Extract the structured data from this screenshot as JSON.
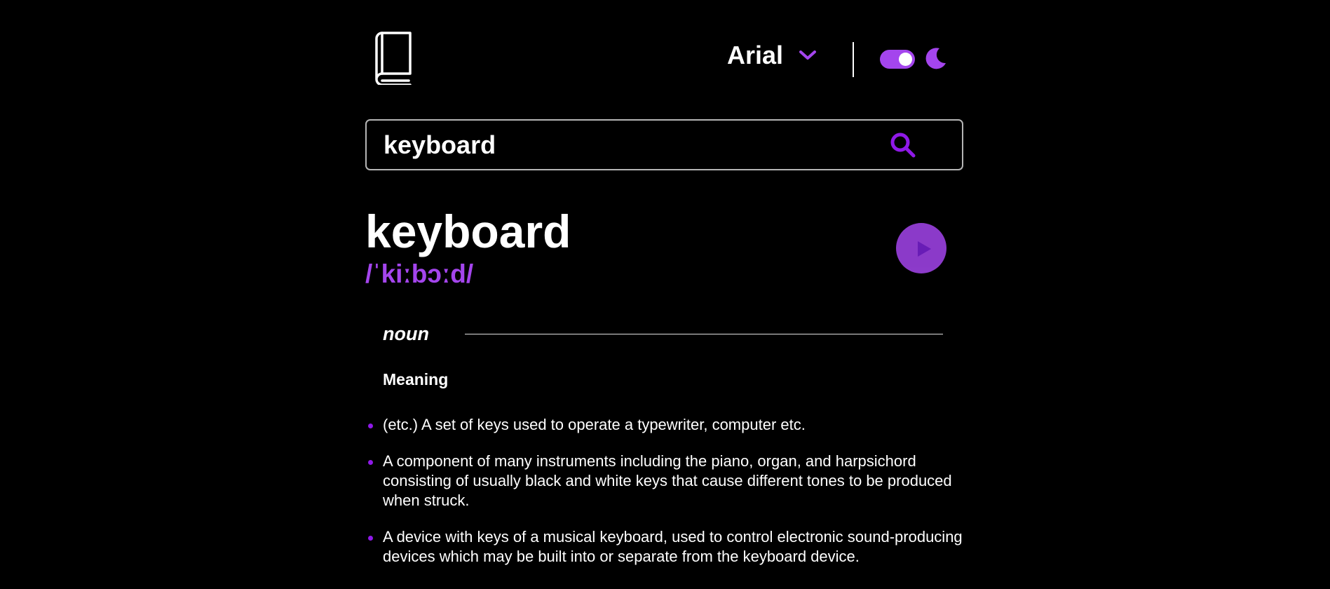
{
  "header": {
    "logo_icon": "book-icon",
    "font_select": {
      "selected": "Arial",
      "icon": "chevron-down-icon"
    },
    "theme_toggle": {
      "state": "dark",
      "icon": "moon-icon"
    }
  },
  "search": {
    "value": "keyboard",
    "icon": "search-icon"
  },
  "entry": {
    "word": "keyboard",
    "phonetic": "/ˈkiːbɔːd/",
    "play_icon": "play-icon",
    "meanings": [
      {
        "part_of_speech": "noun",
        "heading": "Meaning",
        "definitions": [
          "(etc.) A set of keys used to operate a typewriter, computer etc.",
          "A component of many instruments including the piano, organ, and harpsichord consisting of usually black and white keys that cause different tones to be produced when struck.",
          "A device with keys of a musical keyboard, used to control electronic sound-producing devices which may be built into or separate from the keyboard device."
        ]
      }
    ]
  },
  "colors": {
    "background": "#000000",
    "accent": "#a445ed",
    "text": "#ffffff",
    "border": "#b5b5b5"
  }
}
